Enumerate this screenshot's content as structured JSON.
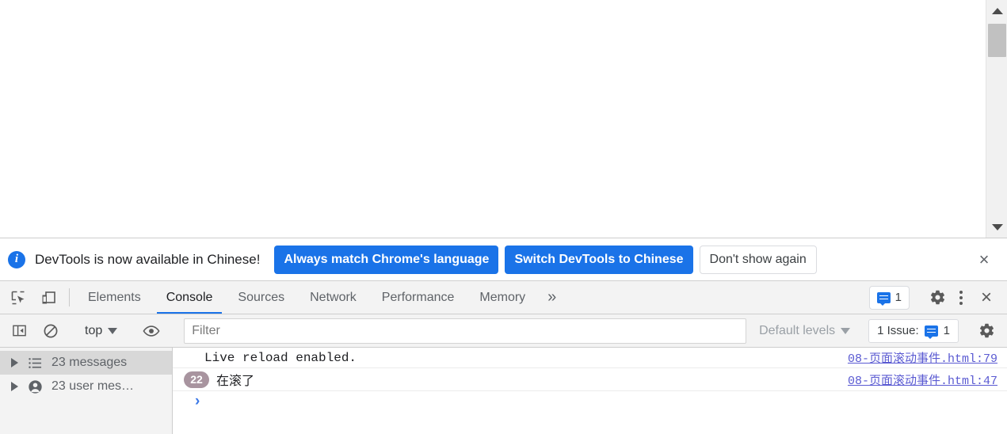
{
  "page": {
    "scrollbar": {
      "up_arrow": "scrollbar-up-arrow",
      "down_arrow": "scrollbar-down-arrow",
      "thumb": "scrollbar-thumb"
    }
  },
  "infobar": {
    "icon": "info-icon",
    "message": "DevTools is now available in Chinese!",
    "primary_buttons": [
      "Always match Chrome's language",
      "Switch DevTools to Chinese"
    ],
    "secondary_button": "Don't show again",
    "close_label": "×",
    "accent_color": "#1a73e8"
  },
  "tabstrip": {
    "inspect_icon": "inspect-element-icon",
    "device_icon": "device-toolbar-icon",
    "tabs": [
      {
        "label": "Elements",
        "active": false
      },
      {
        "label": "Console",
        "active": true
      },
      {
        "label": "Sources",
        "active": false
      },
      {
        "label": "Network",
        "active": false
      },
      {
        "label": "Performance",
        "active": false
      },
      {
        "label": "Memory",
        "active": false
      }
    ],
    "more_tabs_label": "»",
    "issues_badge_count": "1",
    "settings_icon": "gear-icon",
    "more_options_icon": "kebab-menu-icon",
    "close_label": "×",
    "active_tab_underline_color": "#1a73e8"
  },
  "console_toolbar": {
    "sidebar_toggle_icon": "console-sidebar-toggle-icon",
    "clear_icon": "clear-console-icon",
    "context_value": "top",
    "eye_icon": "live-expression-icon",
    "filter_placeholder": "Filter",
    "filter_value": "",
    "levels_value": "Default levels",
    "issue_chip_label": "1 Issue:",
    "issue_chip_count": "1",
    "settings_icon": "console-settings-gear-icon"
  },
  "sidebar": {
    "items": [
      {
        "label": "23 messages",
        "icon": "list-icon",
        "selected": true
      },
      {
        "label": "23 user mes…",
        "icon": "user-icon",
        "selected": false
      }
    ]
  },
  "console_messages": [
    {
      "text": "Live reload enabled.",
      "count": "",
      "source": "08-页面滚动事件.html:79"
    },
    {
      "text": "在滚了",
      "count": "22",
      "source": "08-页面滚动事件.html:47"
    }
  ],
  "prompt": {
    "chevron": "›"
  }
}
